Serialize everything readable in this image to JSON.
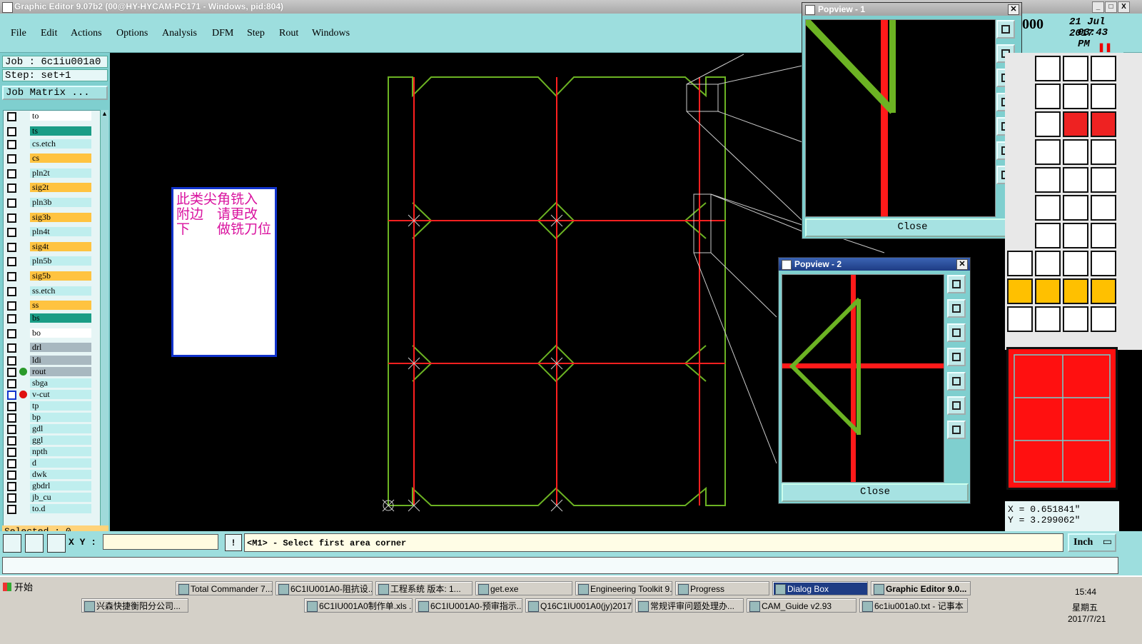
{
  "window": {
    "title": "Graphic Editor 9.07b2 (00@HY-HYCAM-PC171 - Windows, pid:804)",
    "controls": [
      "_",
      "□",
      "X"
    ]
  },
  "menu": {
    "items": [
      "File",
      "Edit",
      "Actions",
      "Options",
      "Analysis",
      "DFM",
      "Step",
      "Rout",
      "Windows"
    ]
  },
  "header_right": {
    "date": "21 Jul 2017",
    "time": "03:43 PM",
    "counter": "000"
  },
  "job": {
    "job_label": "Job : 6c1iu001a0",
    "step_label": "Step: set+1",
    "matrix_button": "Job Matrix ..."
  },
  "layers": [
    {
      "name": "to",
      "color": "#ffffff"
    },
    {
      "name": "ts",
      "color": "#1a9d86"
    },
    {
      "name": "cs.etch",
      "color": "#bfeeee"
    },
    {
      "name": "cs",
      "color": "#ffc340"
    },
    {
      "name": "pln2t",
      "color": "#bfeeee"
    },
    {
      "name": "sig2t",
      "color": "#ffc340"
    },
    {
      "name": "pln3b",
      "color": "#bfeeee"
    },
    {
      "name": "sig3b",
      "color": "#ffc340"
    },
    {
      "name": "pln4t",
      "color": "#bfeeee"
    },
    {
      "name": "sig4t",
      "color": "#ffc340"
    },
    {
      "name": "pln5b",
      "color": "#bfeeee"
    },
    {
      "name": "sig5b",
      "color": "#ffc340"
    },
    {
      "name": "ss.etch",
      "color": "#bfeeee"
    },
    {
      "name": "ss",
      "color": "#ffc340"
    },
    {
      "name": "bs",
      "color": "#1a9d86"
    },
    {
      "name": "bo",
      "color": "#ffffff"
    },
    {
      "name": "drl",
      "color": "#a8b8c0"
    },
    {
      "name": "ldi",
      "color": "#a8b8c0"
    },
    {
      "name": "rout",
      "color": "#a8b8c0"
    },
    {
      "name": "sbga",
      "color": "#bfeeee"
    },
    {
      "name": "v-cut",
      "color": "#bfeeee"
    },
    {
      "name": "tp",
      "color": "#bfeeee"
    },
    {
      "name": "bp",
      "color": "#bfeeee"
    },
    {
      "name": "gdl",
      "color": "#bfeeee"
    },
    {
      "name": "ggl",
      "color": "#bfeeee"
    },
    {
      "name": "npth",
      "color": "#bfeeee"
    },
    {
      "name": "d",
      "color": "#bfeeee"
    },
    {
      "name": "dwk",
      "color": "#bfeeee"
    },
    {
      "name": "gbdrl",
      "color": "#bfeeee"
    },
    {
      "name": "jb_cu",
      "color": "#bfeeee"
    },
    {
      "name": "to.d",
      "color": "#bfeeee"
    }
  ],
  "selected_label": "Selected : 0",
  "note": {
    "lines": [
      "此类尖角铣入",
      "附边　请更改",
      "下　　做铣刀位"
    ]
  },
  "popview1": {
    "title": "Popview - 1",
    "close": "Close"
  },
  "popview2": {
    "title": "Popview - 2",
    "close": "Close"
  },
  "coords": {
    "x": "X = 0.651841\"",
    "y": "Y = 3.299062\""
  },
  "command": {
    "xy_label": "X Y :",
    "xy_value": "",
    "prompt": "<M1> - Select first area corner",
    "units": "Inch"
  },
  "taskbar": {
    "start": "开始",
    "row1": [
      "Total Commander 7....",
      "6C1IU001A0-阻抗设...",
      "工程系统  版本: 1...",
      "get.exe",
      "Engineering Toolkit 9...",
      "Progress",
      "Dialog Box",
      "Graphic Editor 9.0..."
    ],
    "row2": [
      "兴森快捷衡阳分公司...",
      "6C1IU001A0制作单.xls ...",
      "6C1IU001A0-预审指示....",
      "Q16C1IU001A0(jy)2017...",
      "常规评审问题处理办...",
      "CAM_Guide v2.93",
      "6c1iu001a0.txt - 记事本"
    ],
    "clock_time": "15:44",
    "clock_day": "星期五",
    "clock_date": "2017/7/21"
  },
  "colors": {
    "board_outline": "#6cb323",
    "rout_line": "#ff2020",
    "panel_bg": "#7fcfcf",
    "note_text": "#d9119e"
  }
}
